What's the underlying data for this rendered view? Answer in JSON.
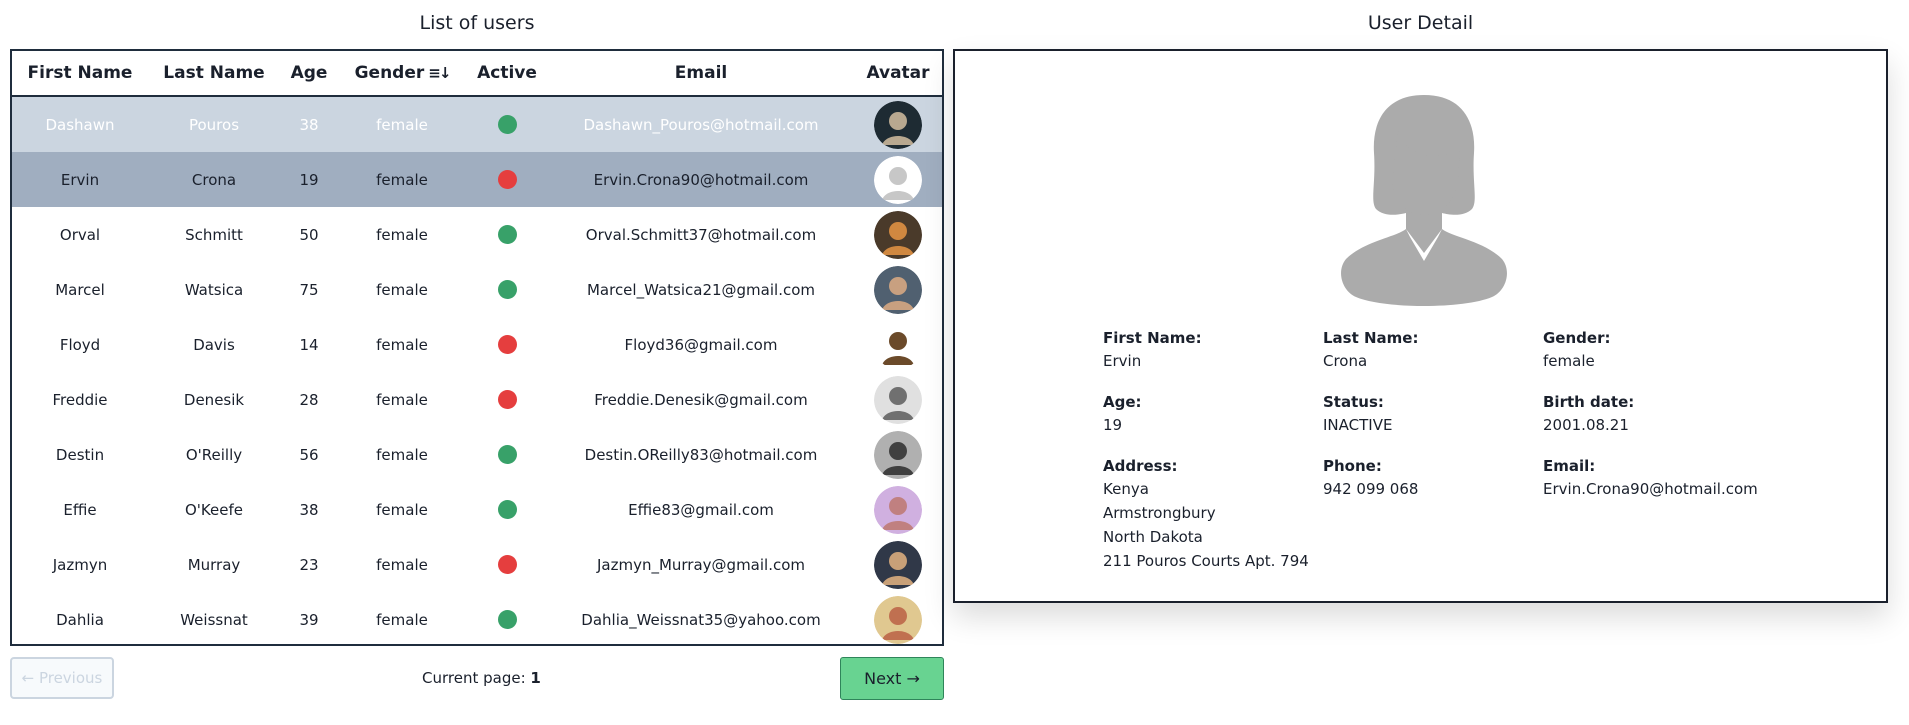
{
  "list_title": "List of users",
  "detail_title": "User Detail",
  "columns": {
    "first_name": "First Name",
    "last_name": "Last Name",
    "age": "Age",
    "gender": "Gender",
    "active": "Active",
    "email": "Email",
    "avatar": "Avatar"
  },
  "rows": [
    {
      "first": "Dashawn",
      "last": "Pouros",
      "age": "38",
      "gender": "female",
      "active": true,
      "email": "Dashawn_Pouros@hotmail.com",
      "avatar": "avatar-dark-face"
    },
    {
      "first": "Ervin",
      "last": "Crona",
      "age": "19",
      "gender": "female",
      "active": false,
      "email": "Ervin.Crona90@hotmail.com",
      "avatar": "avatar-placeholder-female"
    },
    {
      "first": "Orval",
      "last": "Schmitt",
      "age": "50",
      "gender": "female",
      "active": true,
      "email": "Orval.Schmitt37@hotmail.com",
      "avatar": "avatar-glasses-man"
    },
    {
      "first": "Marcel",
      "last": "Watsica",
      "age": "75",
      "gender": "female",
      "active": true,
      "email": "Marcel_Watsica21@gmail.com",
      "avatar": "avatar-man"
    },
    {
      "first": "Floyd",
      "last": "Davis",
      "age": "14",
      "gender": "female",
      "active": false,
      "email": "Floyd36@gmail.com",
      "avatar": "avatar-cartoon"
    },
    {
      "first": "Freddie",
      "last": "Denesik",
      "age": "28",
      "gender": "female",
      "active": false,
      "email": "Freddie.Denesik@gmail.com",
      "avatar": "avatar-bw-beard"
    },
    {
      "first": "Destin",
      "last": "O'Reilly",
      "age": "56",
      "gender": "female",
      "active": true,
      "email": "Destin.OReilly83@hotmail.com",
      "avatar": "avatar-bw-man"
    },
    {
      "first": "Effie",
      "last": "O'Keefe",
      "age": "38",
      "gender": "female",
      "active": true,
      "email": "Effie83@gmail.com",
      "avatar": "avatar-purple-face"
    },
    {
      "first": "Jazmyn",
      "last": "Murray",
      "age": "23",
      "gender": "female",
      "active": false,
      "email": "Jazmyn_Murray@gmail.com",
      "avatar": "avatar-suit-man"
    },
    {
      "first": "Dahlia",
      "last": "Weissnat",
      "age": "39",
      "gender": "female",
      "active": true,
      "email": "Dahlia_Weissnat35@yahoo.com",
      "avatar": "avatar-beach"
    }
  ],
  "pagination": {
    "prev_label": "← Previous",
    "current_label": "Current page:",
    "current_page": "1",
    "next_label": "Next →"
  },
  "detail": {
    "portrait_icon": "female-silhouette-icon",
    "fields": [
      {
        "label": "First Name:",
        "values": [
          "Ervin"
        ]
      },
      {
        "label": "Last Name:",
        "values": [
          "Crona"
        ]
      },
      {
        "label": "Gender:",
        "values": [
          "female"
        ]
      },
      {
        "label": "Age:",
        "values": [
          "19"
        ]
      },
      {
        "label": "Status:",
        "values": [
          "INACTIVE"
        ]
      },
      {
        "label": "Birth date:",
        "values": [
          "2001.08.21"
        ]
      },
      {
        "label": "Address:",
        "values": [
          "Kenya",
          "Armstrongbury",
          "North Dakota",
          "211 Pouros Courts Apt. 794"
        ]
      },
      {
        "label": "Phone:",
        "values": [
          "942 099 068"
        ]
      },
      {
        "label": "Email:",
        "values": [
          "Ervin.Crona90@hotmail.com"
        ]
      }
    ]
  },
  "colors": {
    "active": "#38a169",
    "inactive": "#e53e3e",
    "row_highlight_light": "#cbd5e0",
    "row_highlight_dark": "#a0aec0",
    "next_button": "#68d391"
  }
}
